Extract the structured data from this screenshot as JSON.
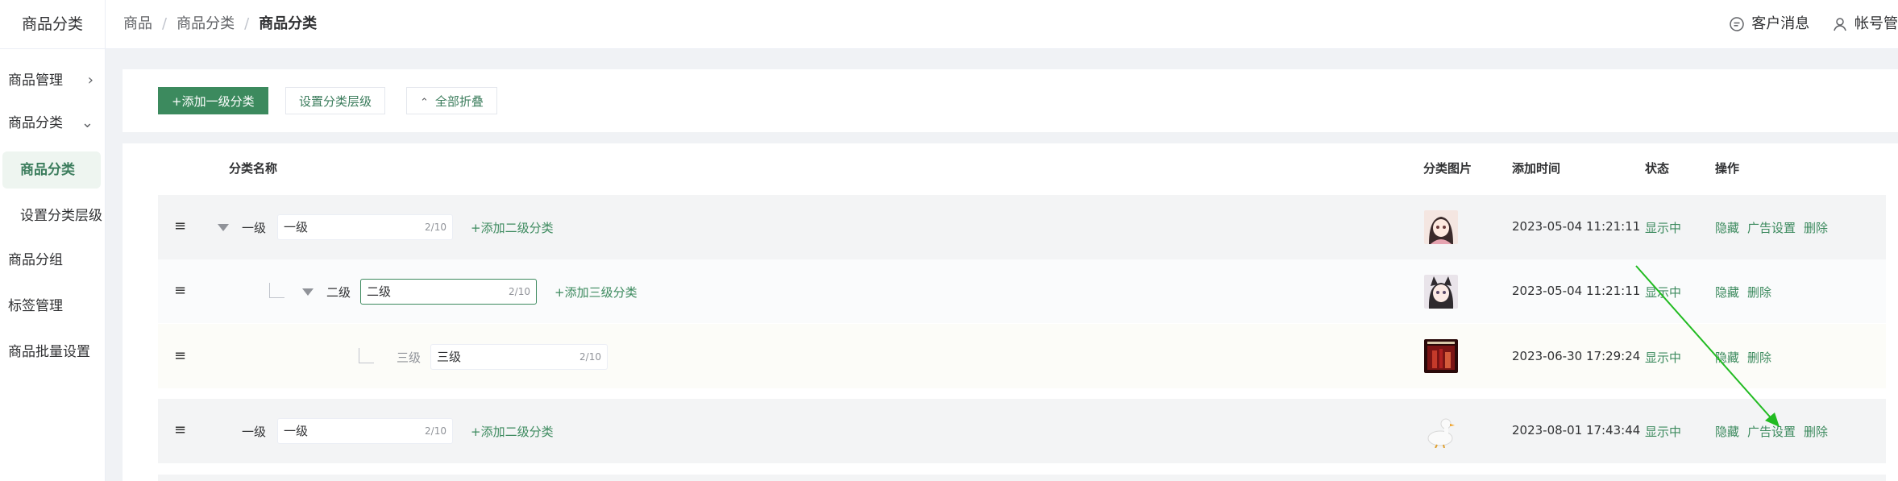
{
  "sidebar": {
    "title": "商品分类",
    "items": [
      {
        "label": "商品管理",
        "chevron": "chevron-right-icon"
      },
      {
        "label": "商品分类",
        "chevron": "chevron-down-icon"
      },
      {
        "label": "商品分类"
      },
      {
        "label": "设置分类层级"
      },
      {
        "label": "商品分组"
      },
      {
        "label": "标签管理"
      },
      {
        "label": "商品批量设置"
      }
    ]
  },
  "header": {
    "breadcrumb": [
      "商品",
      "商品分类",
      "商品分类"
    ],
    "separator": "/",
    "messages_label": "客户消息",
    "account_label": "帐号管"
  },
  "toolbar": {
    "add_primary": "+添加一级分类",
    "set_levels": "设置分类层级",
    "collapse_all": "全部折叠"
  },
  "table": {
    "columns": {
      "name": "分类名称",
      "image": "分类图片",
      "time": "添加时间",
      "status": "状态",
      "ops": "操作"
    },
    "rows": [
      {
        "level_label": "一级",
        "value": "一级",
        "count": "2/10",
        "add_child": "+添加二级分类",
        "time": "2023-05-04 11:21:11",
        "status": "显示中",
        "ops": [
          "隐藏",
          "广告设置",
          "删除"
        ],
        "image": "anime-girl"
      },
      {
        "level_label": "二级",
        "value": "二级",
        "count": "2/10",
        "add_child": "+添加三级分类",
        "time": "2023-05-04 11:21:11",
        "status": "显示中",
        "ops": [
          "隐藏",
          "删除"
        ],
        "image": "anime-catgirl"
      },
      {
        "level_label": "三级",
        "value": "三级",
        "count": "2/10",
        "time": "2023-06-30 17:29:24",
        "status": "显示中",
        "ops": [
          "隐藏",
          "删除"
        ],
        "image": "red-poster"
      },
      {
        "level_label": "一级",
        "value": "一级",
        "count": "2/10",
        "add_child": "+添加二级分类",
        "time": "2023-08-01 17:43:44",
        "status": "显示中",
        "ops": [
          "隐藏",
          "广告设置",
          "删除"
        ],
        "image": "white-duck"
      }
    ]
  },
  "colors": {
    "accent": "#3c8a5e",
    "annotation_arrow": "#22bb22"
  }
}
